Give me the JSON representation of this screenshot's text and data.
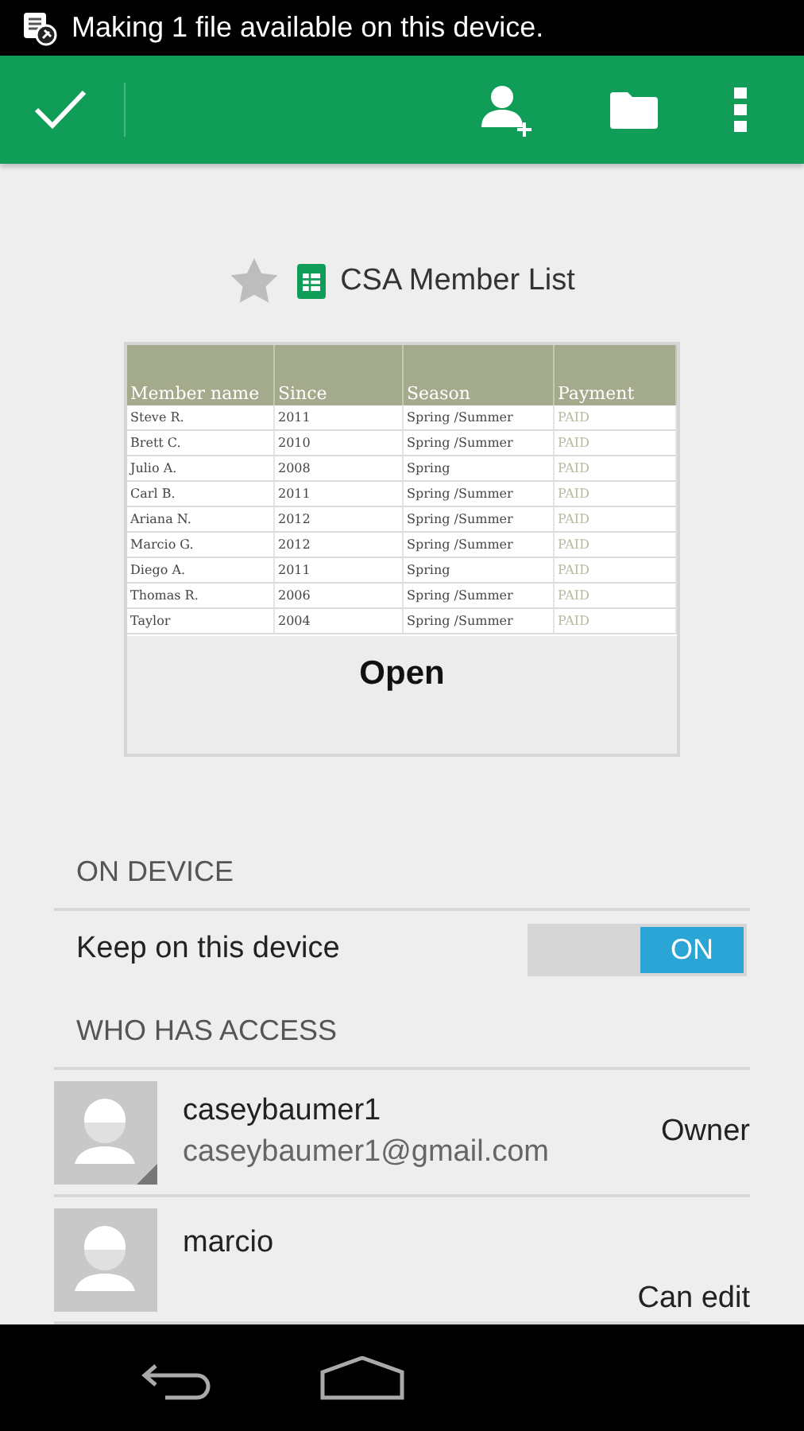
{
  "status_bar": {
    "notification": "Making 1 file available on this device."
  },
  "file": {
    "title": "CSA Member List",
    "starred": false
  },
  "preview": {
    "columns": [
      "Member name",
      "Since",
      "Season",
      "Payment"
    ],
    "rows": [
      [
        "Steve R.",
        "2011",
        "Spring /Summer",
        "PAID"
      ],
      [
        "Brett C.",
        "2010",
        "Spring /Summer",
        "PAID"
      ],
      [
        "Julio A.",
        "2008",
        "Spring",
        "PAID"
      ],
      [
        "Carl B.",
        "2011",
        "Spring /Summer",
        "PAID"
      ],
      [
        "Ariana N.",
        "2012",
        "Spring /Summer",
        "PAID"
      ],
      [
        "Marcio G.",
        "2012",
        "Spring /Summer",
        "PAID"
      ],
      [
        "Diego A.",
        "2011",
        "Spring",
        "PAID"
      ],
      [
        "Thomas R.",
        "2006",
        "Spring /Summer",
        "PAID"
      ],
      [
        "Taylor",
        "2004",
        "Spring /Summer",
        "PAID"
      ]
    ],
    "open_label": "Open"
  },
  "on_device": {
    "heading": "ON DEVICE",
    "label": "Keep on this device",
    "on": true,
    "switch_text": "ON"
  },
  "access": {
    "heading": "WHO HAS ACCESS",
    "people": [
      {
        "name": "caseybaumer1",
        "email": "caseybaumer1@gmail.com",
        "role": "Owner",
        "is_you": true
      },
      {
        "name": "marcio",
        "role": "Can edit",
        "is_you": false
      }
    ]
  }
}
